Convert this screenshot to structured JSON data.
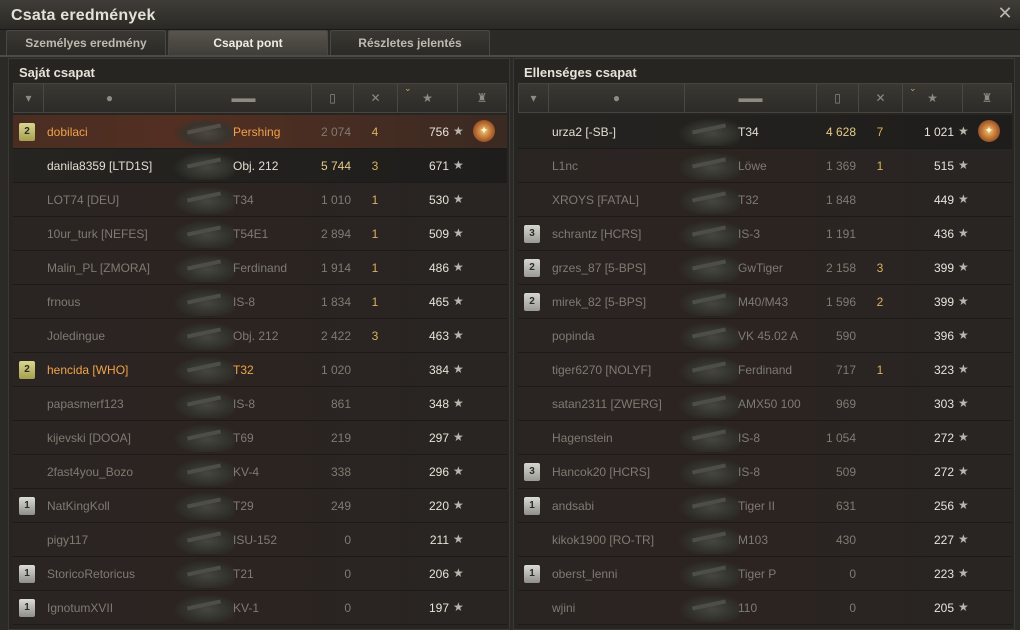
{
  "window": {
    "title": "Csata eredmények",
    "close_glyph": "✕"
  },
  "tabs": [
    {
      "label": "Személyes eredmény",
      "active": false
    },
    {
      "label": "Csapat pont",
      "active": true
    },
    {
      "label": "Részletes jelentés",
      "active": false
    }
  ],
  "columns": {
    "sort_glyph": "⌄",
    "icons": [
      "tier-icon",
      "player-icon",
      "tank-icon",
      "damage-icon",
      "kills-icon",
      "xp-star-icon",
      "medal-icon"
    ]
  },
  "left": {
    "title": "Saját csapat",
    "rows": [
      {
        "badge": "2",
        "badge_class": "b2",
        "name": "dobilaci",
        "tank": "Pershing",
        "damage": "2 074",
        "kills": "4",
        "xp": "756",
        "medal": "✦",
        "style": "orange me"
      },
      {
        "badge": "",
        "badge_class": "",
        "name": "danila8359 [LTD1S]",
        "tank": "Obj. 212",
        "damage": "5 744",
        "kills": "3",
        "xp": "671",
        "medal": "",
        "style": "hi top dmgtop"
      },
      {
        "badge": "",
        "badge_class": "",
        "name": "LOT74 [DEU]",
        "tank": "T34",
        "damage": "1 010",
        "kills": "1",
        "xp": "530",
        "medal": "",
        "style": ""
      },
      {
        "badge": "",
        "badge_class": "",
        "name": "10ur_turk [NEFES]",
        "tank": "T54E1",
        "damage": "2 894",
        "kills": "1",
        "xp": "509",
        "medal": "",
        "style": ""
      },
      {
        "badge": "",
        "badge_class": "",
        "name": "Malin_PL [ZMORA]",
        "tank": "Ferdinand",
        "damage": "1 914",
        "kills": "1",
        "xp": "486",
        "medal": "",
        "style": ""
      },
      {
        "badge": "",
        "badge_class": "",
        "name": "frnous",
        "tank": "IS-8",
        "damage": "1 834",
        "kills": "1",
        "xp": "465",
        "medal": "",
        "style": ""
      },
      {
        "badge": "",
        "badge_class": "",
        "name": "Joledingue",
        "tank": "Obj. 212",
        "damage": "2 422",
        "kills": "3",
        "xp": "463",
        "medal": "",
        "style": ""
      },
      {
        "badge": "2",
        "badge_class": "b2",
        "name": "hencida [WHO]",
        "tank": "T32",
        "damage": "1 020",
        "kills": "",
        "xp": "384",
        "medal": "",
        "style": "orange"
      },
      {
        "badge": "",
        "badge_class": "",
        "name": "papasmerf123",
        "tank": "IS-8",
        "damage": "861",
        "kills": "",
        "xp": "348",
        "medal": "",
        "style": ""
      },
      {
        "badge": "",
        "badge_class": "",
        "name": "kijevski [DOOA]",
        "tank": "T69",
        "damage": "219",
        "kills": "",
        "xp": "297",
        "medal": "",
        "style": ""
      },
      {
        "badge": "",
        "badge_class": "",
        "name": "2fast4you_Bozo",
        "tank": "KV-4",
        "damage": "338",
        "kills": "",
        "xp": "296",
        "medal": "",
        "style": ""
      },
      {
        "badge": "1",
        "badge_class": "b1",
        "name": "NatKingKoll",
        "tank": "T29",
        "damage": "249",
        "kills": "",
        "xp": "220",
        "medal": "",
        "style": ""
      },
      {
        "badge": "",
        "badge_class": "",
        "name": "pigy117",
        "tank": "ISU-152",
        "damage": "0",
        "kills": "",
        "xp": "211",
        "medal": "",
        "style": ""
      },
      {
        "badge": "1",
        "badge_class": "b1",
        "name": "StoricoRetoricus",
        "tank": "T21",
        "damage": "0",
        "kills": "",
        "xp": "206",
        "medal": "",
        "style": ""
      },
      {
        "badge": "1",
        "badge_class": "b1",
        "name": "IgnotumXVII",
        "tank": "KV-1",
        "damage": "0",
        "kills": "",
        "xp": "197",
        "medal": "",
        "style": ""
      }
    ]
  },
  "right": {
    "title": "Ellenséges csapat",
    "rows": [
      {
        "badge": "",
        "badge_class": "",
        "name": "urza2 [-SB-]",
        "tank": "T34",
        "damage": "4 628",
        "kills": "7",
        "xp": "1 021",
        "medal": "✦",
        "style": "hi top dmgtop"
      },
      {
        "badge": "",
        "badge_class": "",
        "name": "L1nc",
        "tank": "Löwe",
        "damage": "1 369",
        "kills": "1",
        "xp": "515",
        "medal": "",
        "style": ""
      },
      {
        "badge": "",
        "badge_class": "",
        "name": "XROYS [FATAL]",
        "tank": "T32",
        "damage": "1 848",
        "kills": "",
        "xp": "449",
        "medal": "",
        "style": ""
      },
      {
        "badge": "3",
        "badge_class": "b3",
        "name": "schrantz [HCRS]",
        "tank": "IS-3",
        "damage": "1 191",
        "kills": "",
        "xp": "436",
        "medal": "",
        "style": ""
      },
      {
        "badge": "2",
        "badge_class": "b3",
        "name": "grzes_87 [5-BPS]",
        "tank": "GwTiger",
        "damage": "2 158",
        "kills": "3",
        "xp": "399",
        "medal": "",
        "style": ""
      },
      {
        "badge": "2",
        "badge_class": "b3",
        "name": "mirek_82 [5-BPS]",
        "tank": "M40/M43",
        "damage": "1 596",
        "kills": "2",
        "xp": "399",
        "medal": "",
        "style": ""
      },
      {
        "badge": "",
        "badge_class": "",
        "name": "popinda",
        "tank": "VK 45.02 A",
        "damage": "590",
        "kills": "",
        "xp": "396",
        "medal": "",
        "style": ""
      },
      {
        "badge": "",
        "badge_class": "",
        "name": "tiger6270 [NOLYF]",
        "tank": "Ferdinand",
        "damage": "717",
        "kills": "1",
        "xp": "323",
        "medal": "",
        "style": ""
      },
      {
        "badge": "",
        "badge_class": "",
        "name": "satan2311 [ZWERG]",
        "tank": "AMX50 100",
        "damage": "969",
        "kills": "",
        "xp": "303",
        "medal": "",
        "style": ""
      },
      {
        "badge": "",
        "badge_class": "",
        "name": "Hagenstein",
        "tank": "IS-8",
        "damage": "1 054",
        "kills": "",
        "xp": "272",
        "medal": "",
        "style": ""
      },
      {
        "badge": "3",
        "badge_class": "b3",
        "name": "Hancok20 [HCRS]",
        "tank": "IS-8",
        "damage": "509",
        "kills": "",
        "xp": "272",
        "medal": "",
        "style": ""
      },
      {
        "badge": "1",
        "badge_class": "b1",
        "name": "andsabi",
        "tank": "Tiger II",
        "damage": "631",
        "kills": "",
        "xp": "256",
        "medal": "",
        "style": ""
      },
      {
        "badge": "",
        "badge_class": "",
        "name": "kikok1900 [RO-TR]",
        "tank": "M103",
        "damage": "430",
        "kills": "",
        "xp": "227",
        "medal": "",
        "style": ""
      },
      {
        "badge": "1",
        "badge_class": "b1",
        "name": "oberst_lenni",
        "tank": "Tiger P",
        "damage": "0",
        "kills": "",
        "xp": "223",
        "medal": "",
        "style": ""
      },
      {
        "badge": "",
        "badge_class": "",
        "name": "wjini",
        "tank": "110",
        "damage": "0",
        "kills": "",
        "xp": "205",
        "medal": "",
        "style": ""
      }
    ]
  },
  "star_glyph": "★"
}
